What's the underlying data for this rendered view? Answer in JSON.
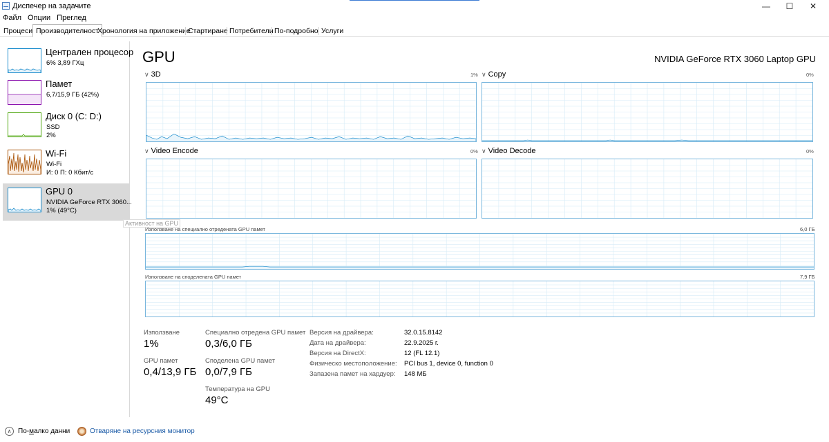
{
  "window": {
    "title": "Диспечер на задачите",
    "minimize": "—",
    "maximize": "☐",
    "close": "✕"
  },
  "menu": [
    "Файл",
    "Опции",
    "Преглед"
  ],
  "tabs": [
    "Процеси",
    "Производителност",
    "Хронология на приложение",
    "Стартиране",
    "Потребители",
    "По-подробно",
    "Услуги"
  ],
  "active_tab": "Производителност",
  "sidebar": {
    "items": [
      {
        "title": "Централен процесор",
        "lines": [
          "6%  3,89 ГХц"
        ],
        "color": "#1a8ccd"
      },
      {
        "title": "Памет",
        "lines": [
          "6,7/15,9 ГБ (42%)"
        ],
        "color": "#8b12ae"
      },
      {
        "title": "Диск 0 (C: D:)",
        "lines": [
          "SSD",
          "2%"
        ],
        "color": "#4da60c"
      },
      {
        "title": "Wi-Fi",
        "lines": [
          "Wi-Fi",
          "И: 0  П: 0 Кбит/с"
        ],
        "color": "#a74f01"
      },
      {
        "title": "GPU 0",
        "lines": [
          "NVIDIA GeForce RTX 3060...",
          "1%  (49°C)"
        ],
        "color": "#1a8ccd"
      }
    ],
    "selected_index": 4,
    "tooltip": "Активност на GPU"
  },
  "main": {
    "title": "GPU",
    "model": "NVIDIA GeForce RTX 3060 Laptop GPU",
    "engines": [
      {
        "name": "3D",
        "percent": "1%"
      },
      {
        "name": "Copy",
        "percent": "0%"
      },
      {
        "name": "Video Encode",
        "percent": "0%"
      },
      {
        "name": "Video Decode",
        "percent": "0%"
      }
    ],
    "dedicated": {
      "label": "Използване на специално отредената GPU памет",
      "max": "6,0 ГБ"
    },
    "shared": {
      "label": "Използване на споделената GPU памет",
      "max": "7,9 ГБ"
    },
    "stats": {
      "utilization_label": "Използване",
      "utilization": "1%",
      "dedicated_label": "Специално отредена GPU памет",
      "dedicated": "0,3/6,0 ГБ",
      "gpu_memory_label": "GPU памет",
      "gpu_memory": "0,4/13,9 ГБ",
      "shared_label": "Споделена GPU памет",
      "shared": "0,0/7,9 ГБ",
      "temp_label": "Температура на GPU",
      "temp": "49°C"
    },
    "info": [
      {
        "label": "Версия на драйвера:",
        "value": "32.0.15.8142"
      },
      {
        "label": "Дата на драйвера:",
        "value": "22.9.2025 г."
      },
      {
        "label": "Версия на DirectX:",
        "value": "12 (FL 12.1)"
      },
      {
        "label": "Физическо местоположение:",
        "value": "PCI bus 1, device 0, function 0"
      },
      {
        "label": "Запазена памет на хардуер:",
        "value": "148 МБ"
      }
    ]
  },
  "footer": {
    "fewer_details_prefix": "По-",
    "fewer_details_underlined": "м",
    "fewer_details_suffix": "алко данни",
    "resource_monitor": "Отваряне на ресурсния монитор"
  },
  "colors": {
    "chart_border": "#78b6dd",
    "grid": "#d6ebf7",
    "line": "#1a8ccd",
    "fill": "#e8f4fb"
  }
}
